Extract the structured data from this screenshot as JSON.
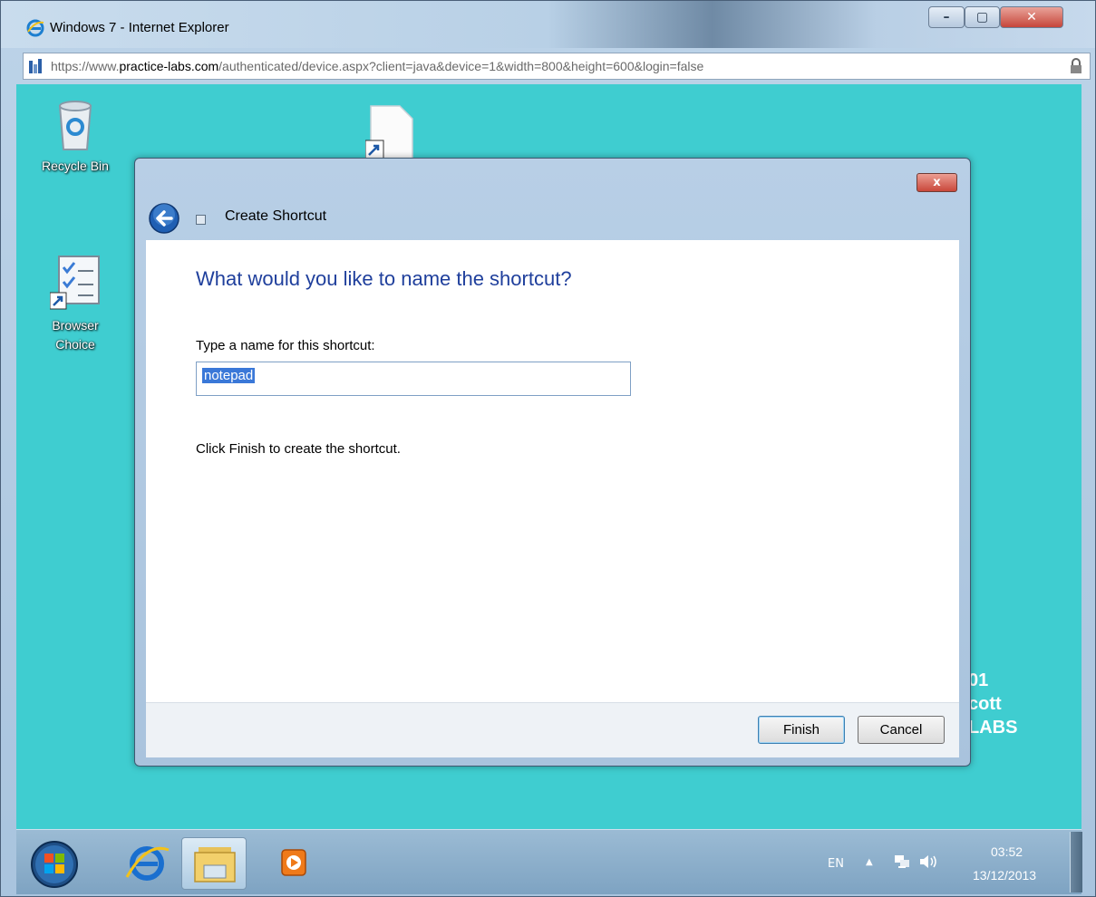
{
  "browser": {
    "title": "Windows 7 - Internet Explorer",
    "url_scheme": "https://www.",
    "url_domain": "practice-labs.com",
    "url_path": "/authenticated/device.aspx?client=java&device=1&width=800&height=600&login=false"
  },
  "desktop": {
    "icons": [
      {
        "label": "Recycle Bin",
        "icon": "recycle-bin-icon"
      },
      {
        "label": "Browser Choice",
        "icon": "browser-choice-icon"
      },
      {
        "label": "",
        "icon": "document-shortcut-icon"
      }
    ],
    "watermark_lines": [
      "01",
      "cott",
      "LABS"
    ]
  },
  "dialog": {
    "title": "Create Shortcut",
    "close_label": "x",
    "heading": "What would you like to name the shortcut?",
    "field_label": "Type a name for this shortcut:",
    "field_value": "notepad",
    "hint": "Click Finish to create the shortcut.",
    "finish_label": "Finish",
    "cancel_label": "Cancel"
  },
  "taskbar": {
    "items": [
      "start-orb",
      "internet-explorer",
      "windows-explorer",
      "media-player"
    ],
    "language": "EN",
    "time": "03:52",
    "date": "13/12/2013"
  },
  "colors": {
    "desktop": "#3fcdd0",
    "heading": "#1f3f9c",
    "selection": "#3a78d8"
  }
}
